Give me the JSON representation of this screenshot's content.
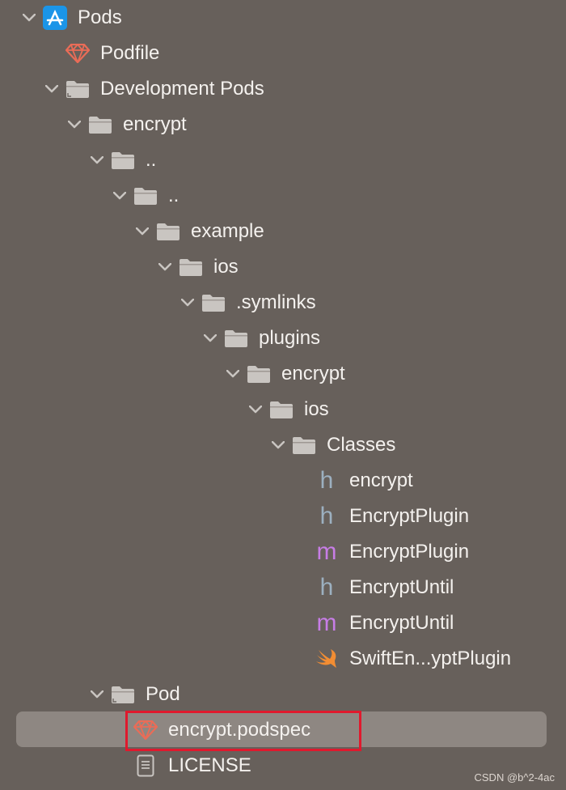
{
  "tree": {
    "pods": "Pods",
    "podfile": "Podfile",
    "development_pods": "Development Pods",
    "encrypt_group": "encrypt",
    "parent1": "..",
    "parent2": "..",
    "example": "example",
    "ios": "ios",
    "symlinks": ".symlinks",
    "plugins": "plugins",
    "encrypt_plugin": "encrypt",
    "ios2": "ios",
    "classes": "Classes",
    "encrypt_h": "encrypt",
    "encryptplugin_h": "EncryptPlugin",
    "encryptplugin_m": "EncryptPlugin",
    "encryptuntil_h": "EncryptUntil",
    "encryptuntil_m": "EncryptUntil",
    "swift_plugin": "SwiftEn...yptPlugin",
    "pod": "Pod",
    "podspec": "encrypt.podspec",
    "license": "LICENSE"
  },
  "file_badges": {
    "header": "h",
    "impl": "m"
  },
  "watermark": "CSDN @b^2-4ac",
  "colors": {
    "background": "#67605b",
    "selection": "#8e8681",
    "highlight_border": "#e0192d",
    "folder_gray": "#c9c5c1",
    "ruby_red": "#ea6c57",
    "xcode_blue": "#1b95e8",
    "swift_orange": "#f28d33",
    "header_blue": "#9cb0c0",
    "impl_purple": "#c77de6"
  }
}
